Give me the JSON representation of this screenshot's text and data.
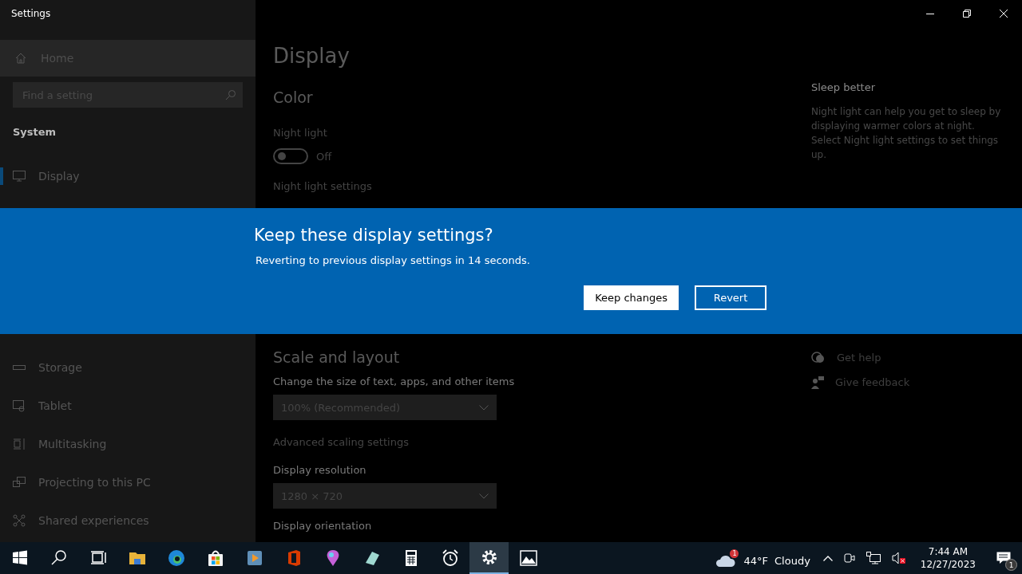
{
  "window": {
    "title": "Settings"
  },
  "sidebar": {
    "home": "Home",
    "search": {
      "placeholder": "Find a setting"
    },
    "section": "System",
    "items_top": [
      {
        "label": "Display",
        "selected": true
      }
    ],
    "items_bottom": [
      {
        "label": "Storage",
        "selected": false
      },
      {
        "label": "Tablet",
        "selected": false
      },
      {
        "label": "Multitasking",
        "selected": false
      },
      {
        "label": "Projecting to this PC",
        "selected": false
      },
      {
        "label": "Shared experiences",
        "selected": false
      }
    ]
  },
  "main": {
    "title": "Display",
    "color_heading": "Color",
    "night_light": {
      "label": "Night light",
      "on": false,
      "state_text": "Off",
      "link": "Night light settings"
    },
    "scale_heading": "Scale and layout",
    "scale_label": "Change the size of text, apps, and other items",
    "scale_value": "100% (Recommended)",
    "advanced_link": "Advanced scaling settings",
    "resolution_label": "Display resolution",
    "resolution_value": "1280 × 720",
    "orientation_label": "Display orientation"
  },
  "aside": {
    "title": "Sleep better",
    "text": "Night light can help you get to sleep by displaying warmer colors at night. Select Night light settings to set things up.",
    "links": [
      "Get help",
      "Give feedback"
    ]
  },
  "dialog": {
    "title": "Keep these display settings?",
    "message": "Reverting to previous display settings in 14 seconds.",
    "buttons": [
      {
        "label": "Keep changes",
        "kind": "primary"
      },
      {
        "label": "Revert",
        "kind": "secondary"
      }
    ]
  },
  "taskbar": {
    "apps": [
      {
        "selected": false
      },
      {
        "selected": false
      },
      {
        "selected": false
      },
      {
        "selected": false
      },
      {
        "selected": false
      },
      {
        "selected": false
      },
      {
        "selected": false
      },
      {
        "selected": false
      },
      {
        "selected": false
      },
      {
        "selected": false
      },
      {
        "selected": false
      },
      {
        "selected": false
      },
      {
        "selected": true
      },
      {
        "selected": false
      }
    ],
    "weather": {
      "badge": "1",
      "temperature": "44°F",
      "condition": "Cloudy"
    },
    "time": "7:44 AM",
    "date": "12/27/2023",
    "notifications": "1"
  }
}
